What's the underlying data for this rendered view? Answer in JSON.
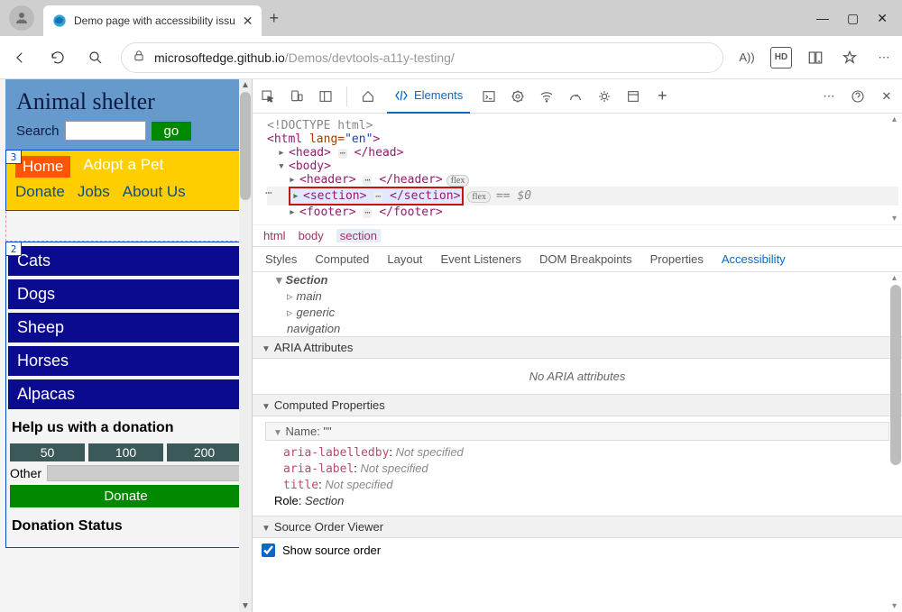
{
  "tab": {
    "title": "Demo page with accessibility issu"
  },
  "url": {
    "host": "microsoftedge.github.io",
    "path": "/Demos/devtools-a11y-testing/"
  },
  "toolbar_icons": {
    "read_aloud": "A))",
    "hd": "HD"
  },
  "demo": {
    "header_title": "Animal shelter",
    "search_label": "Search",
    "go": "go",
    "nav": {
      "home": "Home",
      "adopt": "Adopt a Pet",
      "donate": "Donate",
      "jobs": "Jobs",
      "about": "About Us"
    },
    "source_order": {
      "sidebar": "2",
      "nav": "3"
    },
    "animals": [
      "Cats",
      "Dogs",
      "Sheep",
      "Horses",
      "Alpacas"
    ],
    "donation": {
      "heading": "Help us with a donation",
      "amounts": [
        "50",
        "100",
        "200"
      ],
      "other_label": "Other",
      "button": "Donate",
      "status_heading": "Donation Status"
    }
  },
  "devtools": {
    "elements_tab": "Elements",
    "dom": {
      "doctype": "<!DOCTYPE html>",
      "html_open": "<html ",
      "html_attr": "lang=",
      "html_val": "\"en\"",
      "html_close": ">",
      "head": {
        "open": "<head>",
        "close": "</head>"
      },
      "body": "<body>",
      "header": {
        "open": "<header>",
        "close": "</header>",
        "badge": "flex"
      },
      "section": {
        "open": "<section>",
        "close": "</section>",
        "badge": "flex",
        "eq": "== $0"
      },
      "footer": {
        "open": "<footer>",
        "close": "</footer>"
      }
    },
    "breadcrumb": [
      "html",
      "body",
      "section"
    ],
    "subtabs": [
      "Styles",
      "Computed",
      "Layout",
      "Event Listeners",
      "DOM Breakpoints",
      "Properties",
      "Accessibility"
    ],
    "a11y": {
      "tree": [
        "Section",
        "main",
        "generic",
        "navigation"
      ],
      "aria_header": "ARIA Attributes",
      "no_aria": "No ARIA attributes",
      "computed_header": "Computed Properties",
      "name_label": "Name: \"\"",
      "props": [
        {
          "k": "aria-labelledby",
          "v": "Not specified"
        },
        {
          "k": "aria-label",
          "v": "Not specified"
        },
        {
          "k": "title",
          "v": "Not specified"
        }
      ],
      "role_label": "Role:",
      "role_value": "Section",
      "source_order_header": "Source Order Viewer",
      "show_source_order": "Show source order"
    }
  }
}
